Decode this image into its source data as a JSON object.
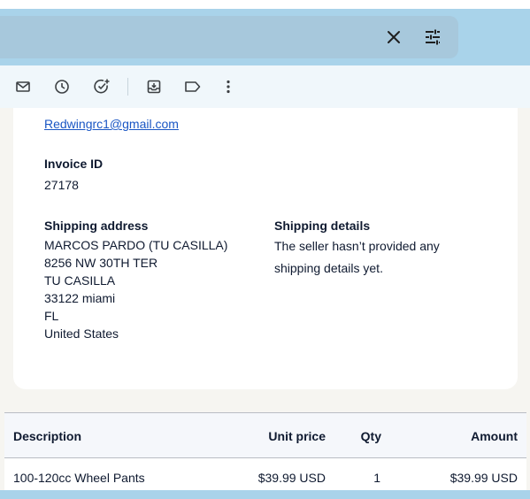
{
  "search": {
    "close_icon": "close-icon",
    "filter_icon": "tune-icon"
  },
  "toolbar": {
    "icons": [
      "mail-icon",
      "clock-icon",
      "add-task-icon",
      "move-to-inbox-icon",
      "label-icon",
      "more-vertical-icon"
    ]
  },
  "invoice": {
    "email": "Redwingrc1@gmail.com",
    "invoice_id_label": "Invoice ID",
    "invoice_id": "27178",
    "shipping_address_label": "Shipping address",
    "shipping_address_lines": [
      "MARCOS PARDO (TU CASILLA)",
      "8256 NW 30TH TER",
      "TU CASILLA",
      "33122 miami",
      "FL",
      "United States"
    ],
    "shipping_details_label": "Shipping details",
    "shipping_details_lines": [
      "The seller hasn’t provided any",
      "shipping details yet."
    ]
  },
  "table": {
    "headers": {
      "description": "Description",
      "unit_price": "Unit price",
      "qty": "Qty",
      "amount": "Amount"
    },
    "rows": [
      {
        "description": "100-120cc Wheel Pants",
        "unit_price": "$39.99 USD",
        "qty": "1",
        "amount": "$39.99 USD"
      }
    ]
  }
}
